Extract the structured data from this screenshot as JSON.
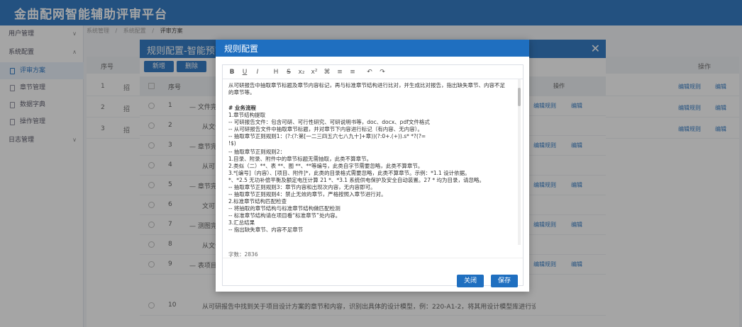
{
  "app": {
    "title": "金曲配网智能辅助评审平台"
  },
  "sidebar": {
    "groups": [
      {
        "label": "用户管理"
      },
      {
        "label": "系统配置"
      },
      {
        "label": "日志管理"
      }
    ],
    "items": [
      {
        "label": "评审方案"
      },
      {
        "label": "章节管理"
      },
      {
        "label": "数据字典"
      },
      {
        "label": "操作管理"
      }
    ]
  },
  "breadcrumb": [
    "系统管理",
    "系统配置",
    "评审方案"
  ],
  "background_table": {
    "header_no": "序号",
    "header_ops": "操作",
    "rows": [
      {
        "no": "1",
        "name": "招"
      },
      {
        "no": "2",
        "name": "招"
      },
      {
        "no": "3",
        "name": "招"
      }
    ],
    "link_edit_rule": "编辑规则",
    "link_edit": "编辑"
  },
  "under_dialog": {
    "title": "规则配置-智能预审",
    "add_btn": "新增",
    "delete_btn": "删除",
    "header_no": "序号",
    "header_ops": "操作",
    "rows": [
      {
        "no": "1",
        "name": "— 文件完整",
        "lk1": "编辑规则",
        "lk2": "编辑"
      },
      {
        "no": "2",
        "name": "从文件",
        "lk1": "",
        "lk2": ""
      },
      {
        "no": "3",
        "name": "— 章节完整",
        "lk1": "编辑规则",
        "lk2": "编辑"
      },
      {
        "no": "4",
        "name": "从可",
        "lk1": "",
        "lk2": ""
      },
      {
        "no": "5",
        "name": "— 章节完整",
        "lk1": "编辑规则",
        "lk2": "编辑"
      },
      {
        "no": "6",
        "name": "文可",
        "lk1": "",
        "lk2": ""
      },
      {
        "no": "7",
        "name": "— 测图完整",
        "lk1": "编辑规则",
        "lk2": "编辑"
      },
      {
        "no": "8",
        "name": "从文件",
        "lk1": "",
        "lk2": ""
      },
      {
        "no": "9",
        "name": "— 表项目",
        "lk1": "编辑规则",
        "lk2": "编辑"
      },
      {
        "no": "10",
        "name": "从可研报告中找到关于项目设计方案的章节和内容，识别出具体的设计模型，例：220-A1-2，将其用设计模型库进行设计查询...",
        "lk1": "",
        "lk2": ""
      }
    ]
  },
  "modal": {
    "title": "规则配置",
    "toolbar": [
      "B",
      "U",
      "I",
      "H",
      "S",
      "x₂",
      "x²",
      "⌘",
      "≡",
      "≡",
      "↶",
      "↷"
    ],
    "content_lines": [
      "从可研报告中抽取章节标题及章节内容标记，再与标准章节结构进行比对，并生成比对报告，指出缺失章节、内容不足",
      "的章节等。",
      "",
      "# 业务流程",
      "1.章节结构提取",
      "  -- 可研报告文件：包含可研、可行性研究、可研说明书等，doc、docx、pdf文件格式",
      "  -- 从可研报告文件中抽取章节标题，并对章节下内容进行标记（有内容、无内容）。",
      "  -- 抽取章节正则规则1：(?:(?:第[一二三四五六七八九十]+章))(?:0+.(+)).s* *?(?=",
      "!$)",
      "  -- 抽取章节正则规则2：",
      "      1.目录、附录、附件中的章节标题无需抽取，此类不算章节。",
      "      2.类似（二）**、表 **、图 **、**等编号，此类自字节需要忽略，此类不算章节。",
      "      3.*[编号]（内容）、[项目、附件]*，此类的目录格式需要忽略，此类不算章节。示例：*1.1 设计依据。",
      "  *、*2.5 无功补偿平衡及额定电压计算 21  *、*3.1 系统供电保护及安全自动装置。27 * 均为目录，请忽略。",
      "  -- 抽取章节正则规则3：章节内容和出现次内容，无内容即可。",
      "  -- 抽取章节正则规则4：禁止无效的章节，严格按照入章节进行对。",
      "2.标准章节结构匹配检查",
      "  -- 将抽取的章节结构与标准章节结构做匹配检测",
      "  -- 标准章节结构请在项目看“标准章节”处内容。",
      "3.汇总结果",
      "  -- 指出缺失章节、内容不足章节"
    ],
    "word_count": "字数：2836",
    "close_btn": "关闭",
    "save_btn": "保存"
  },
  "colors": {
    "primary": "#1f6fc0"
  }
}
